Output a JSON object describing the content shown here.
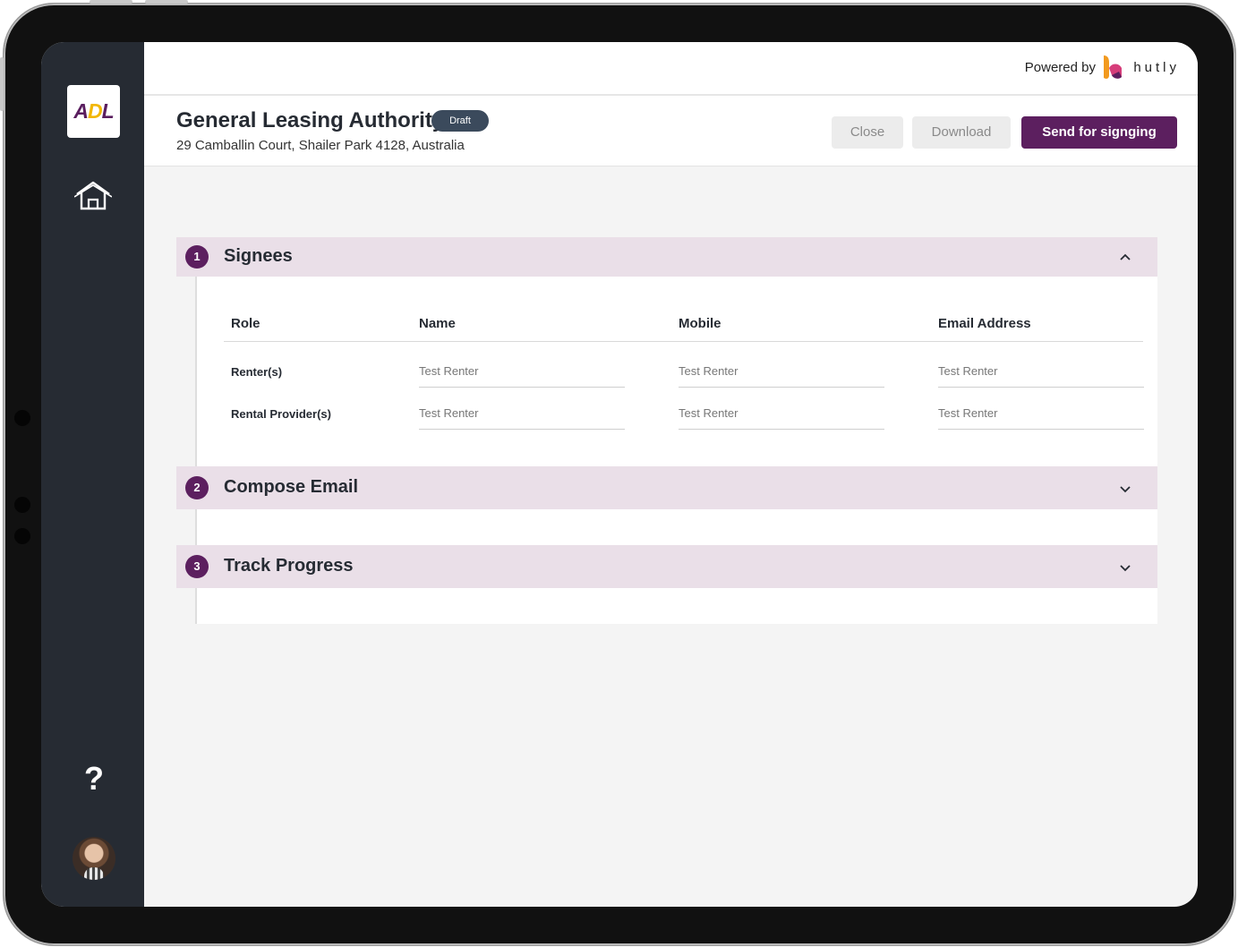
{
  "topbar": {
    "powered_by": "Powered by",
    "brand": "hutly"
  },
  "sidebar": {
    "logo_text": [
      "A",
      "D",
      "L"
    ],
    "help": "?"
  },
  "header": {
    "title": "General Leasing Authority",
    "status_badge": "Draft",
    "address": "29 Camballin Court, Shailer Park 4128, Australia",
    "buttons": {
      "close": "Close",
      "download": "Download",
      "send": "Send for signging"
    }
  },
  "sections": [
    {
      "number": "1",
      "title": "Signees",
      "expanded": true
    },
    {
      "number": "2",
      "title": "Compose Email",
      "expanded": false
    },
    {
      "number": "3",
      "title": "Track Progress",
      "expanded": false
    }
  ],
  "signees": {
    "columns": [
      "Role",
      "Name",
      "Mobile",
      "Email Address"
    ],
    "rows": [
      {
        "role": "Renter(s)",
        "name": "Test Renter",
        "mobile": "Test Renter",
        "email": "Test Renter"
      },
      {
        "role": "Rental Provider(s)",
        "name": "Test Renter",
        "mobile": "Test Renter",
        "email": "Test Renter"
      }
    ]
  },
  "colors": {
    "brand_purple": "#5c1f5f",
    "section_bg": "#eadfe8",
    "sidebar_bg": "#262b33",
    "badge_bg": "#3b4a5c"
  }
}
